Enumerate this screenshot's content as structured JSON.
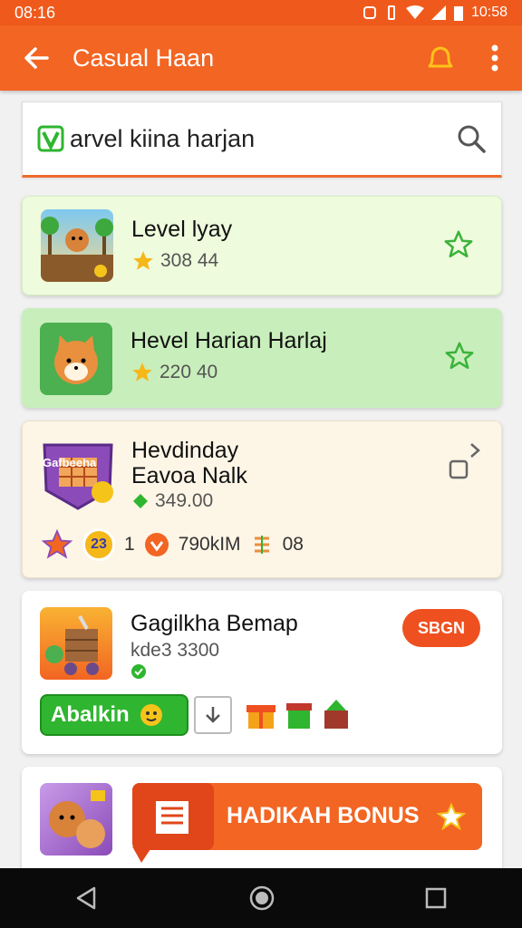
{
  "status": {
    "time": "08:16",
    "clock": "10:58"
  },
  "appbar": {
    "title": "Casual Haan"
  },
  "search": {
    "query": "arvel kiina harjan"
  },
  "cards": [
    {
      "title": "Level lyay",
      "score": "308 44",
      "bg": "#eefbdc"
    },
    {
      "title": "Hevel Harian Harlaj",
      "score": "220 40",
      "bg": "#c8eebc"
    },
    {
      "title_line1": "Hevdinday",
      "title_line2": "Eavoa Nalk",
      "price": "349.00",
      "badge_text": "Gafbeeha",
      "badge_num": "23",
      "count": "1",
      "distance": "790kIM",
      "extra": "08",
      "bg": "#fdf5e6"
    },
    {
      "title": "Gagilkha Bemap",
      "sub": "kde3 3300",
      "action": "SBGN",
      "install": "Abalkin",
      "bg": "#ffffff"
    },
    {
      "banner": "HADIKAH BONUS",
      "bg": "#ffffff"
    }
  ],
  "colors": {
    "accent": "#f26522",
    "green": "#2fb52f",
    "gold": "#f5b81b"
  },
  "icons": [
    "back-arrow-icon",
    "bell-icon",
    "more-vert-icon",
    "search-icon",
    "star-outline-icon",
    "star-icon",
    "chevron-right-icon",
    "checkbox-icon",
    "download-icon",
    "gift-icon",
    "nav-back-icon",
    "nav-home-icon",
    "nav-recents-icon"
  ]
}
